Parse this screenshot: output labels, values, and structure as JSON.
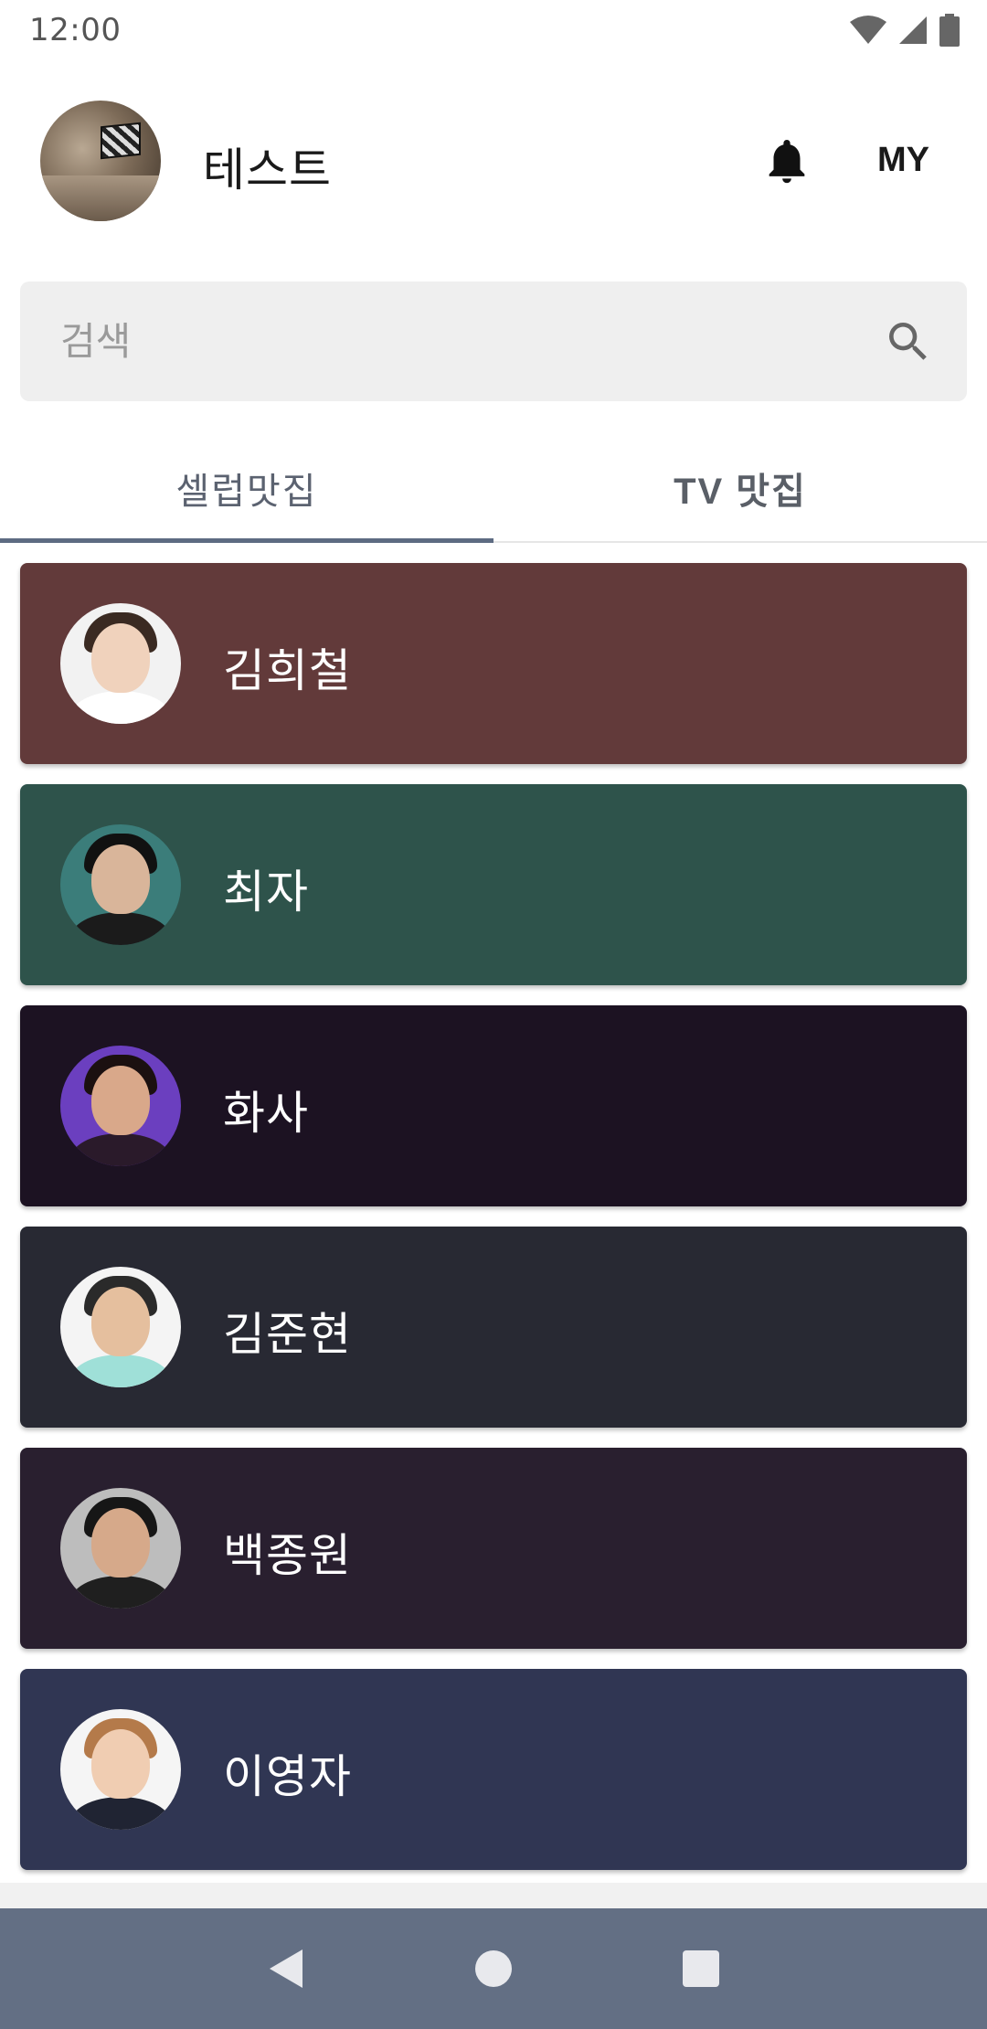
{
  "status_bar": {
    "time": "12:00"
  },
  "header": {
    "user_name": "테스트",
    "my_label": "MY"
  },
  "search": {
    "placeholder": "검색"
  },
  "tabs": [
    {
      "label": "셀럽맛집",
      "active": true
    },
    {
      "label": "TV 맛집",
      "active": false
    }
  ],
  "celebs": [
    {
      "name": "김희철",
      "color": "#623a3a",
      "avatar_bg": "#f2f2f2",
      "avatar_body": "#ffffff",
      "hair": "#3a2a22",
      "skin": "#f0d2bc"
    },
    {
      "name": "최자",
      "color": "#2e534b",
      "avatar_bg": "#3b7d7a",
      "avatar_body": "#1b1b1b",
      "hair": "#111111",
      "skin": "#d9b59a"
    },
    {
      "name": "화사",
      "color": "#1c1222",
      "avatar_bg": "#6b3fbf",
      "avatar_body": "#2a1a2a",
      "hair": "#1b1010",
      "skin": "#d9a88a"
    },
    {
      "name": "김준현",
      "color": "#282933",
      "avatar_bg": "#f4f4f4",
      "avatar_body": "#9fe0d8",
      "hair": "#2a2a2a",
      "skin": "#e5bf9e"
    },
    {
      "name": "백종원",
      "color": "#291f2f",
      "avatar_bg": "#bdbdbd",
      "avatar_body": "#1f1f1f",
      "hair": "#161616",
      "skin": "#d6a98a"
    },
    {
      "name": "이영자",
      "color": "#303653",
      "avatar_bg": "#f5f5f5",
      "avatar_body": "#202433",
      "hair": "#b47a4a",
      "skin": "#f0cdb2"
    }
  ],
  "icons": {
    "bell": "bell-icon",
    "search": "search-icon",
    "back": "back-icon",
    "home": "home-icon",
    "recents": "recents-icon"
  }
}
